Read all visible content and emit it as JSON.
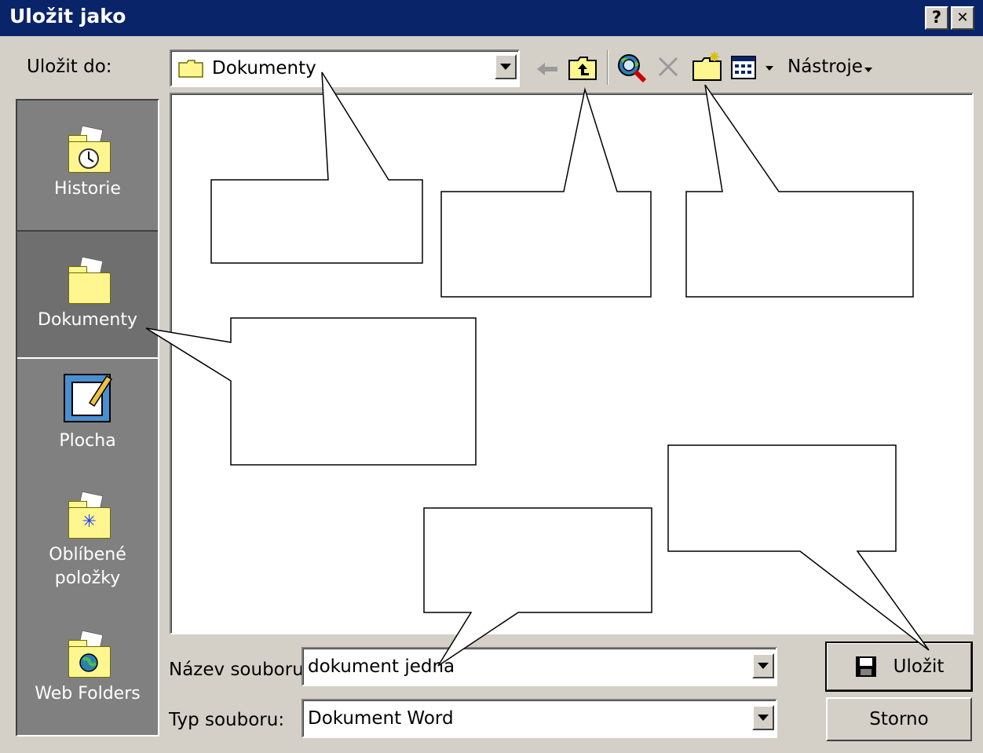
{
  "window": {
    "title": "Uložit jako",
    "help_btn": "?",
    "close_btn": "✕"
  },
  "toolbar": {
    "save_in_label": "Uložit do:",
    "location_value": "Dokumenty",
    "tools_label": "Nástroje",
    "icons": [
      "back-arrow-icon",
      "up-one-level-icon",
      "search-web-icon",
      "delete-icon",
      "new-folder-icon",
      "views-icon"
    ]
  },
  "places": [
    {
      "label": "Historie",
      "icon": "history-folder-icon"
    },
    {
      "label": "Dokumenty",
      "icon": "documents-folder-icon"
    },
    {
      "label": "Plocha",
      "icon": "desktop-icon"
    },
    {
      "label": "Oblíbené položky",
      "icon": "favorites-folder-icon"
    },
    {
      "label": "Web Folders",
      "icon": "web-folders-icon"
    }
  ],
  "form": {
    "filename_label": "Název souboru:",
    "filename_value": "dokument jedna",
    "filetype_label": "Typ souboru:",
    "filetype_value": "Dokument Word"
  },
  "buttons": {
    "save": "Uložit",
    "cancel": "Storno"
  },
  "colors": {
    "titlebar": "#0a246a",
    "face": "#d4d0c8",
    "places_bg": "#808080",
    "folder": "#fff68f"
  }
}
